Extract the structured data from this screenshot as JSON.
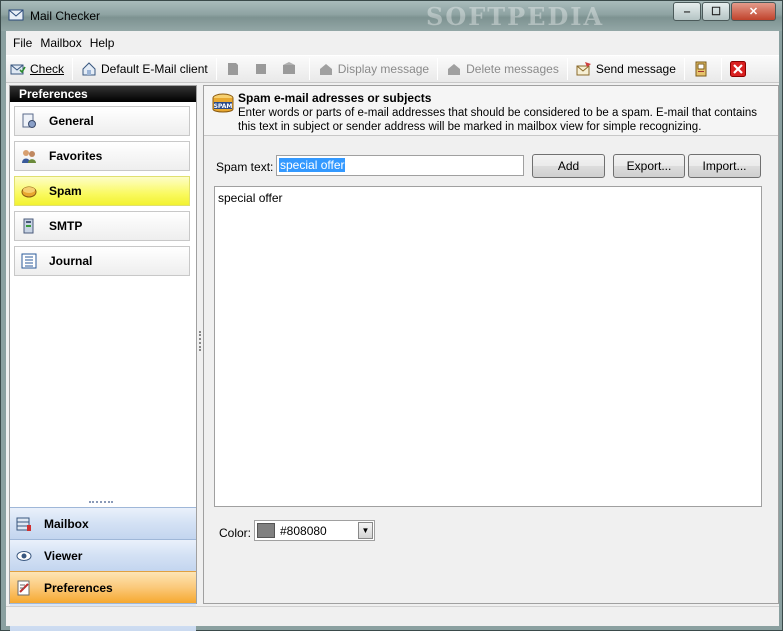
{
  "window": {
    "title": "Mail Checker",
    "watermark": "SOFTPEDIA",
    "controls": {
      "minimize": "‒",
      "maximize": "☐",
      "close": "✕"
    }
  },
  "menu": [
    "File",
    "Mailbox",
    "Help"
  ],
  "toolbar": {
    "check": "Check",
    "default_client": "Default E-Mail client",
    "display_message": "Display message",
    "delete_messages": "Delete messages",
    "send_message": "Send message"
  },
  "left_panel": {
    "header": "Preferences",
    "items": [
      {
        "label": "General",
        "icon": "general-icon",
        "active": false
      },
      {
        "label": "Favorites",
        "icon": "favorites-icon",
        "active": false
      },
      {
        "label": "Spam",
        "icon": "spam-icon",
        "active": true
      },
      {
        "label": "SMTP",
        "icon": "smtp-icon",
        "active": false
      },
      {
        "label": "Journal",
        "icon": "journal-icon",
        "active": false
      }
    ],
    "bottom_nav": [
      {
        "label": "Mailbox",
        "icon": "mailbox-icon",
        "active": false
      },
      {
        "label": "Viewer",
        "icon": "viewer-icon",
        "active": false
      },
      {
        "label": "Preferences",
        "icon": "preferences-icon",
        "active": true
      }
    ]
  },
  "spam_page": {
    "title": "Spam e-mail adresses or subjects",
    "description": "Enter words or parts of e-mail addresses that should be considered to be a spam. E-mail that contains this text in subject or sender address will be marked in mailbox view for simple recognizing.",
    "input_label": "Spam text:",
    "input_value": "special offer",
    "buttons": {
      "add": "Add",
      "export": "Export...",
      "import": "Import..."
    },
    "entries": [
      "special offer"
    ],
    "color_label": "Color:",
    "color_value": "#808080"
  },
  "colors": {
    "active_nav": "#fafa60",
    "active_bottom_nav": "#f6a830",
    "selection": "#3399ff",
    "swatch": "#808080"
  }
}
